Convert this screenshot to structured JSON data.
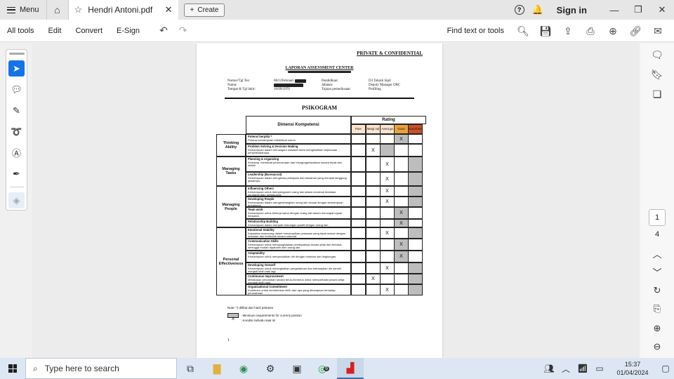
{
  "tabbar": {
    "menu_label": "Menu",
    "doc_tab_title": "Hendri Antoni.pdf",
    "create_label": "Create",
    "signin_label": "Sign in"
  },
  "toolbar": {
    "all_tools": "All tools",
    "edit": "Edit",
    "convert": "Convert",
    "esign": "E-Sign",
    "find_label": "Find text or tools"
  },
  "pagenav": {
    "current": "1",
    "total": "4"
  },
  "document": {
    "confidential": "PRIVATE & CONFIDENTIAL",
    "report_title": "LAPORAN ASSESSMENT CENTER",
    "info_left_labels": [
      "Nomor/Tgl Tes:",
      "Nama:",
      "Tempat & Tgl lahir:"
    ],
    "info_left_values": [
      "08/12Februari",
      "",
      "16/09/1970"
    ],
    "info_right_labels": [
      "Pendidikan:",
      "Jabatan:",
      "Tujuan pemeriksaan:"
    ],
    "info_right_values": [
      "D3 Teknik Sipil",
      "Deputy Manager OBC",
      "Profiling"
    ],
    "psikogram": "PSIKOGRAM",
    "dimensi_header": "Dimensi Kompetensi",
    "rating_header": "Rating",
    "rating_cols": [
      "Poor",
      "Margi nal",
      "Avera ge",
      "Good",
      "Excell ent"
    ],
    "groups": [
      {
        "name": "Thinking Ability"
      },
      {
        "name": "Managing Tasks"
      },
      {
        "name": "Managing People"
      },
      {
        "name": "Personal Effectiveness"
      }
    ],
    "rows": [
      {
        "title": "Potensi berpikir *",
        "desc": "Potensi kemampuan intelektual umum"
      },
      {
        "title": "Problem Solving & Decision Making",
        "desc": "Kemampuan dalam menangani masalah serta menghasilkan keputusan penyelesaiannya."
      },
      {
        "title": "Planning & organizing",
        "desc": "Kemamp. membuat perencanaan dan mengorganisasikan secara tepat dan efektif."
      },
      {
        "title": "Leadership (Bureaucrat)",
        "desc": "Kemampuan dalam mengelola pekerjaan dan bawahan yang menjadi tanggung jawabnya."
      },
      {
        "title": "Influencing Others",
        "desc": "Kemampuan untuk mempengaruhi orang lain dalam merubah tindakan, pendapat atau perilakunya."
      },
      {
        "title": "Developing People",
        "desc": "Kemampuan dalam mengembangkan orang lain sesuai dengan kemampuan terbaiknya."
      },
      {
        "title": "Team work",
        "desc": "Kemampuan untuk bekerja sama dengan orang lain dalam mencapai tujuan bersama."
      },
      {
        "title": "Relationship Building",
        "desc": "Kemampuan dalam menjalin hubungan positif dengan orang lain."
      },
      {
        "title": "Emotional Stability",
        "desc": "Kapasitas seseorang dalam menampilkan perasaan yang tepat sesuai dengan keadaan dan bertindak secara rasional."
      },
      {
        "title": "Communication Skills",
        "desc": "Kemampuan untuk mengungkapkan pendapatnya secara jelas dan terbuka, sehingga mudah dipahami oleh orang lain."
      },
      {
        "title": "Adaptability",
        "desc": "Kemampuan untuk menyesuaikan diri dengan tuntutan dan lingkungan."
      },
      {
        "title": "Developing Oneself",
        "desc": "Kemampuan untuk meningkatkan pengetahuan dan ketrampilan diri sendiri menjadi lebih baik lagi."
      },
      {
        "title": "Continuous Improvement",
        "desc": "Melakukan perubahan secara terus-menerus untuk memperbaiki proses kerja menjadi lebih baik."
      },
      {
        "title": "Organizational Commitment",
        "desc": "Komitmen untuk memberikan lebih dari apa yang diharapkan terhadap perusahaan."
      }
    ],
    "marks": [
      "X",
      "X",
      "X",
      "X",
      "X",
      "X",
      "X",
      "X",
      "X",
      "X",
      "X",
      "X",
      "X",
      "X"
    ],
    "note_line1": "Note: *) dilihat dari hasil psikotes",
    "legend_shade": ": Minimum requirements for current position",
    "legend_x_symbol": "X",
    "legend_x": ": Kondisi individu saat ini",
    "page_number": "1"
  },
  "taskbar": {
    "search_placeholder": "Type here to search",
    "time": "15:37",
    "date": "01/04/2024",
    "badge": "6"
  },
  "colors": {
    "accent": "#1473e6",
    "good_header": "#e8a43c",
    "excellent_header": "#c8502a",
    "header_cell": "#fbe3cf",
    "shaded": "#bdbdbd"
  }
}
